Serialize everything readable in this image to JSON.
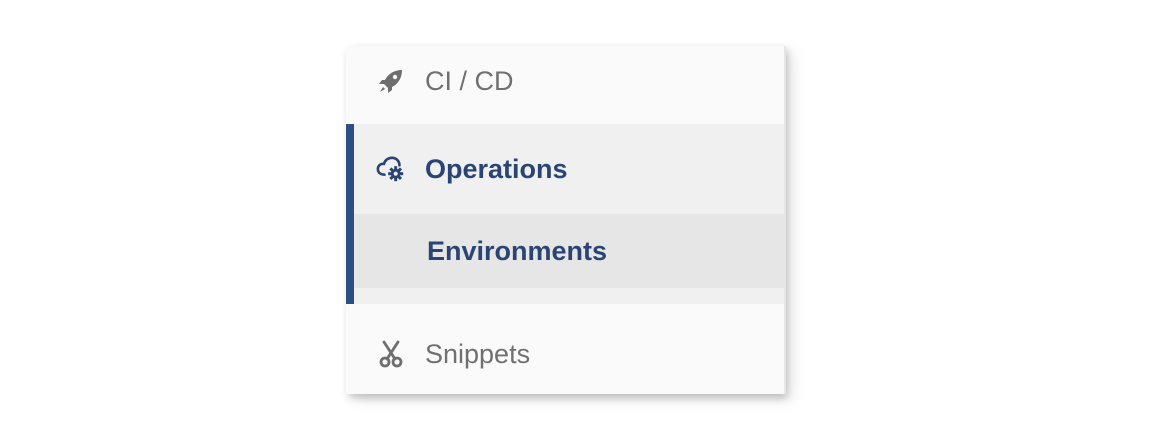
{
  "sidebar": {
    "items": [
      {
        "label": "CI / CD",
        "icon": "rocket-icon"
      },
      {
        "label": "Operations",
        "icon": "cloud-gear-icon",
        "active": true,
        "subitems": [
          {
            "label": "Environments",
            "active": true
          }
        ]
      },
      {
        "label": "Snippets",
        "icon": "scissors-icon"
      }
    ]
  },
  "colors": {
    "accent": "#2e4f81",
    "active_text": "#2a4573",
    "inactive_text": "#707070",
    "panel_bg": "#fafafa",
    "active_group_bg": "#f0f0f0",
    "active_subitem_bg": "#e6e6e6"
  }
}
